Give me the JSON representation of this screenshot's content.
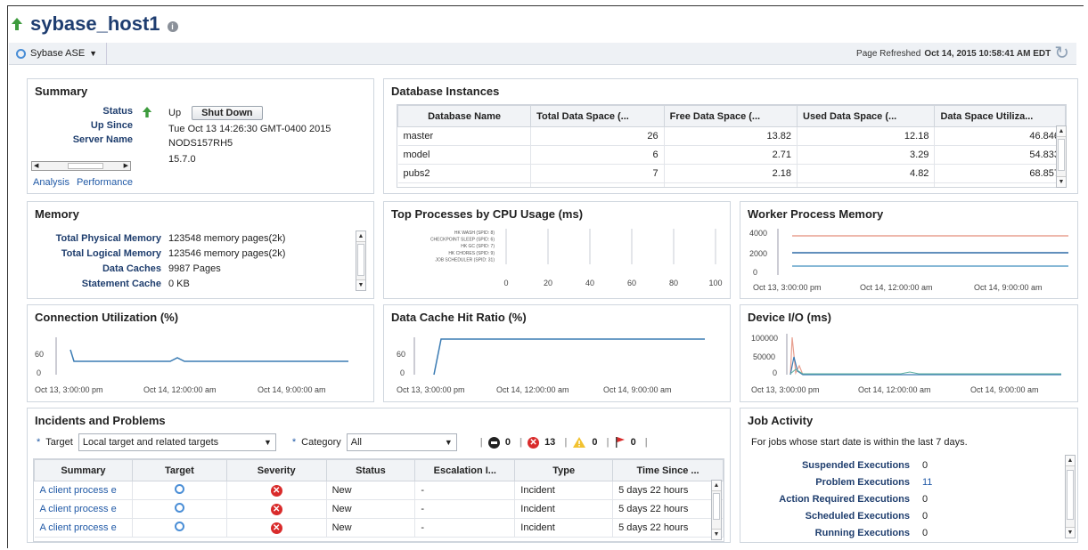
{
  "header": {
    "title": "sybase_host1",
    "info_icon": "info-icon",
    "status_icon": "up-arrow-icon"
  },
  "target_bar": {
    "target_type": "Sybase ASE",
    "refresh_prefix": "Page Refreshed",
    "refresh_time": "Oct 14, 2015 10:58:41 AM EDT"
  },
  "summary": {
    "title": "Summary",
    "status_label": "Status",
    "status_value": "Up",
    "shutdown_button": "Shut Down",
    "up_since_label": "Up Since",
    "up_since_value": "Tue Oct 13 14:26:30 GMT-0400 2015",
    "server_name_label": "Server Name",
    "server_name_value": "NODS157RH5",
    "version_value": "15.7.0",
    "links": {
      "analysis": "Analysis",
      "performance": "Performance"
    }
  },
  "db_instances": {
    "title": "Database Instances",
    "columns": [
      "Database Name",
      "Total Data Space (...",
      "Free Data Space (...",
      "Used Data Space (...",
      "Data Space Utiliza..."
    ],
    "rows": [
      [
        "master",
        "26",
        "13.82",
        "12.18",
        "46.846"
      ],
      [
        "model",
        "6",
        "2.71",
        "3.29",
        "54.833"
      ],
      [
        "pubs2",
        "7",
        "2.18",
        "4.82",
        "68.857"
      ]
    ]
  },
  "memory": {
    "title": "Memory",
    "rows": [
      {
        "label": "Total Physical Memory",
        "value": "123548 memory pages(2k)"
      },
      {
        "label": "Total Logical Memory",
        "value": "123546 memory pages(2k)"
      },
      {
        "label": "Data Caches",
        "value": "9987 Pages"
      },
      {
        "label": "Statement Cache",
        "value": "0 KB"
      }
    ]
  },
  "top_processes": {
    "title": "Top Processes by CPU Usage (ms)",
    "processes": [
      "HK WASH (SPID: 8)",
      "CHECKPOINT SLEEP (SPID: 6)",
      "HK GC (SPID: 7)",
      "HK CHORES (SPID: 9)",
      "JOB SCHEDULER (SPID: 31)"
    ],
    "x_ticks": [
      "0",
      "20",
      "40",
      "60",
      "80",
      "100"
    ]
  },
  "worker_memory": {
    "title": "Worker Process Memory",
    "y_ticks": [
      "4000",
      "2000",
      "0"
    ],
    "x_ticks": [
      "Oct 13, 3:00:00 pm",
      "Oct 14, 12:00:00 am",
      "Oct 14, 9:00:00 am"
    ],
    "colors": [
      "#e8a090",
      "#2d6aa6",
      "#5ea0c8"
    ]
  },
  "connection_util": {
    "title": "Connection Utilization (%)",
    "y_ticks": [
      "60",
      "0"
    ],
    "x_ticks": [
      "Oct 13, 3:00:00 pm",
      "Oct 14, 12:00:00 am",
      "Oct 14, 9:00:00 am"
    ]
  },
  "data_cache": {
    "title": "Data Cache Hit Ratio (%)",
    "y_ticks": [
      "60",
      "0"
    ],
    "x_ticks": [
      "Oct 13, 3:00:00 pm",
      "Oct 14, 12:00:00 am",
      "Oct 14, 9:00:00 am"
    ]
  },
  "device_io": {
    "title": "Device I/O (ms)",
    "y_ticks": [
      "100000",
      "50000",
      "0"
    ],
    "x_ticks": [
      "Oct 13, 3:00:00 pm",
      "Oct 14, 12:00:00 am",
      "Oct 14, 9:00:00 am"
    ]
  },
  "incidents": {
    "title": "Incidents and Problems",
    "target_label": "Target",
    "target_value": "Local target and related targets",
    "category_label": "Category",
    "category_value": "All",
    "counts": {
      "fatal": "0",
      "critical": "13",
      "warning": "0",
      "escalated": "0"
    },
    "columns": [
      "Summary",
      "Target",
      "Severity",
      "Status",
      "Escalation I...",
      "Type",
      "Time Since ..."
    ],
    "rows": [
      {
        "summary": "A client process e",
        "status": "New",
        "escalation": "-",
        "type": "Incident",
        "time": "5 days 22 hours"
      },
      {
        "summary": "A client process e",
        "status": "New",
        "escalation": "-",
        "type": "Incident",
        "time": "5 days 22 hours"
      },
      {
        "summary": "A client process e",
        "status": "New",
        "escalation": "-",
        "type": "Incident",
        "time": "5 days 22 hours"
      }
    ]
  },
  "job_activity": {
    "title": "Job Activity",
    "description": "For jobs whose start date is within the last 7 days.",
    "rows": [
      {
        "label": "Suspended Executions",
        "value": "0"
      },
      {
        "label": "Problem Executions",
        "value": "11"
      },
      {
        "label": "Action Required Executions",
        "value": "0"
      },
      {
        "label": "Scheduled Executions",
        "value": "0"
      },
      {
        "label": "Running Executions",
        "value": "0"
      }
    ]
  }
}
